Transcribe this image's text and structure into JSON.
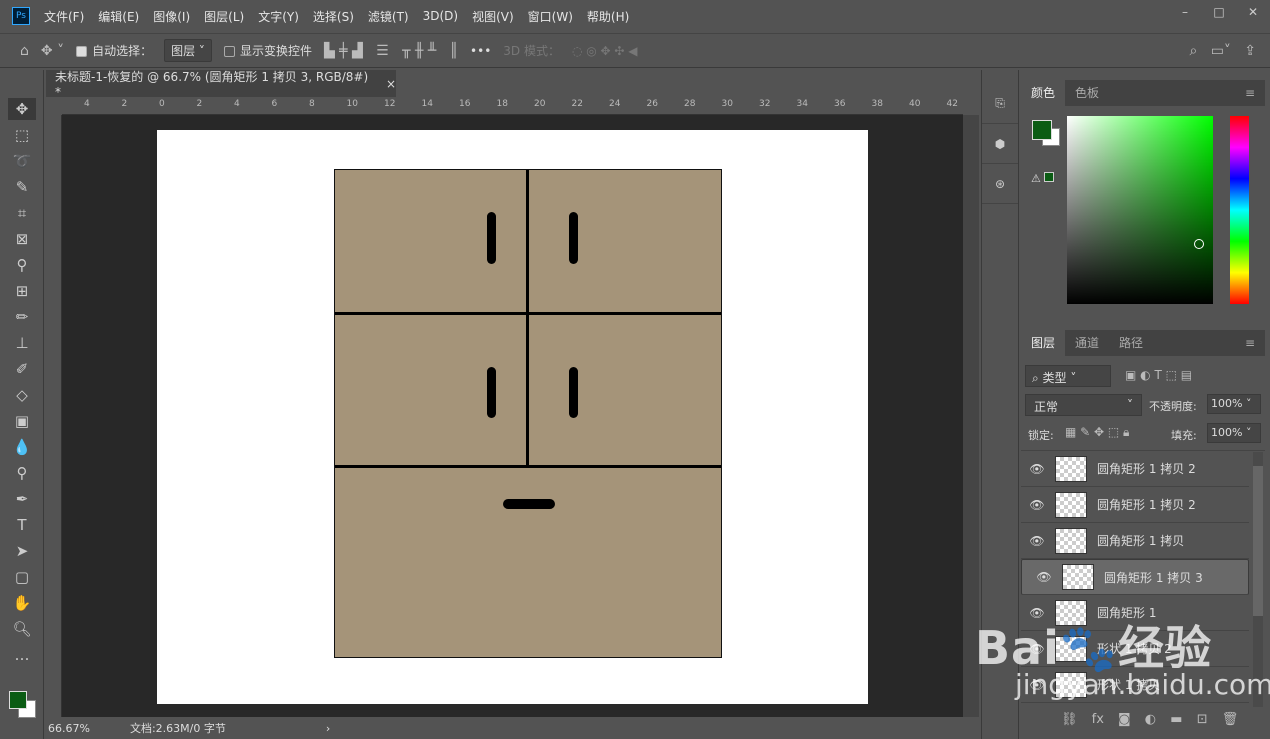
{
  "app": {
    "logo": "Ps"
  },
  "menu": [
    "文件(F)",
    "编辑(E)",
    "图像(I)",
    "图层(L)",
    "文字(Y)",
    "选择(S)",
    "滤镜(T)",
    "3D(D)",
    "视图(V)",
    "窗口(W)",
    "帮助(H)"
  ],
  "window_controls": [
    "–",
    "□",
    "✕"
  ],
  "options": {
    "auto_select_label": "自动选择：",
    "auto_select_checked": true,
    "auto_select_value": "图层",
    "show_transform_label": "显示变换控件",
    "show_transform_checked": false,
    "more": "•••",
    "mode_3d": "3D 模式："
  },
  "document_tab": {
    "title": "未标题-1-恢复的 @ 66.7% (圆角矩形 1 拷贝 3, RGB/8#) *",
    "close": "×"
  },
  "ruler_ticks": [
    "4",
    "2",
    "0",
    "2",
    "4",
    "6",
    "8",
    "10",
    "12",
    "14",
    "16",
    "18",
    "20",
    "22",
    "24",
    "26",
    "28",
    "30",
    "32",
    "34",
    "36",
    "38",
    "40",
    "42"
  ],
  "status": {
    "zoom": "66.67%",
    "doc": "文档:2.63M/0 字节",
    "arrow": "›"
  },
  "color_panel": {
    "tabs": [
      "颜色",
      "色板"
    ],
    "foreground": "#0b5c14",
    "background": "#ffffff"
  },
  "layers_panel": {
    "tabs": [
      "图层",
      "通道",
      "路径"
    ],
    "filter": "类型",
    "blend_mode": "正常",
    "opacity_label": "不透明度:",
    "opacity": "100%",
    "lock_label": "锁定:",
    "fill_label": "填充:",
    "fill": "100%",
    "layers": [
      {
        "name": "圆角矩形 1 拷贝 2",
        "selected": false
      },
      {
        "name": "圆角矩形 1 拷贝 2",
        "selected": false
      },
      {
        "name": "圆角矩形 1 拷贝",
        "selected": false
      },
      {
        "name": "圆角矩形 1 拷贝 3",
        "selected": true
      },
      {
        "name": "圆角矩形 1",
        "selected": false
      },
      {
        "name": "形状 1 拷贝 2",
        "selected": false
      },
      {
        "name": "形状 1 拷贝",
        "selected": false
      }
    ],
    "footer_fx": "fx"
  },
  "watermark": "Baidu经验 jingyan.baidu.com",
  "colors": {
    "cabinet": "#a59479",
    "canvas_bg": "#282828"
  }
}
